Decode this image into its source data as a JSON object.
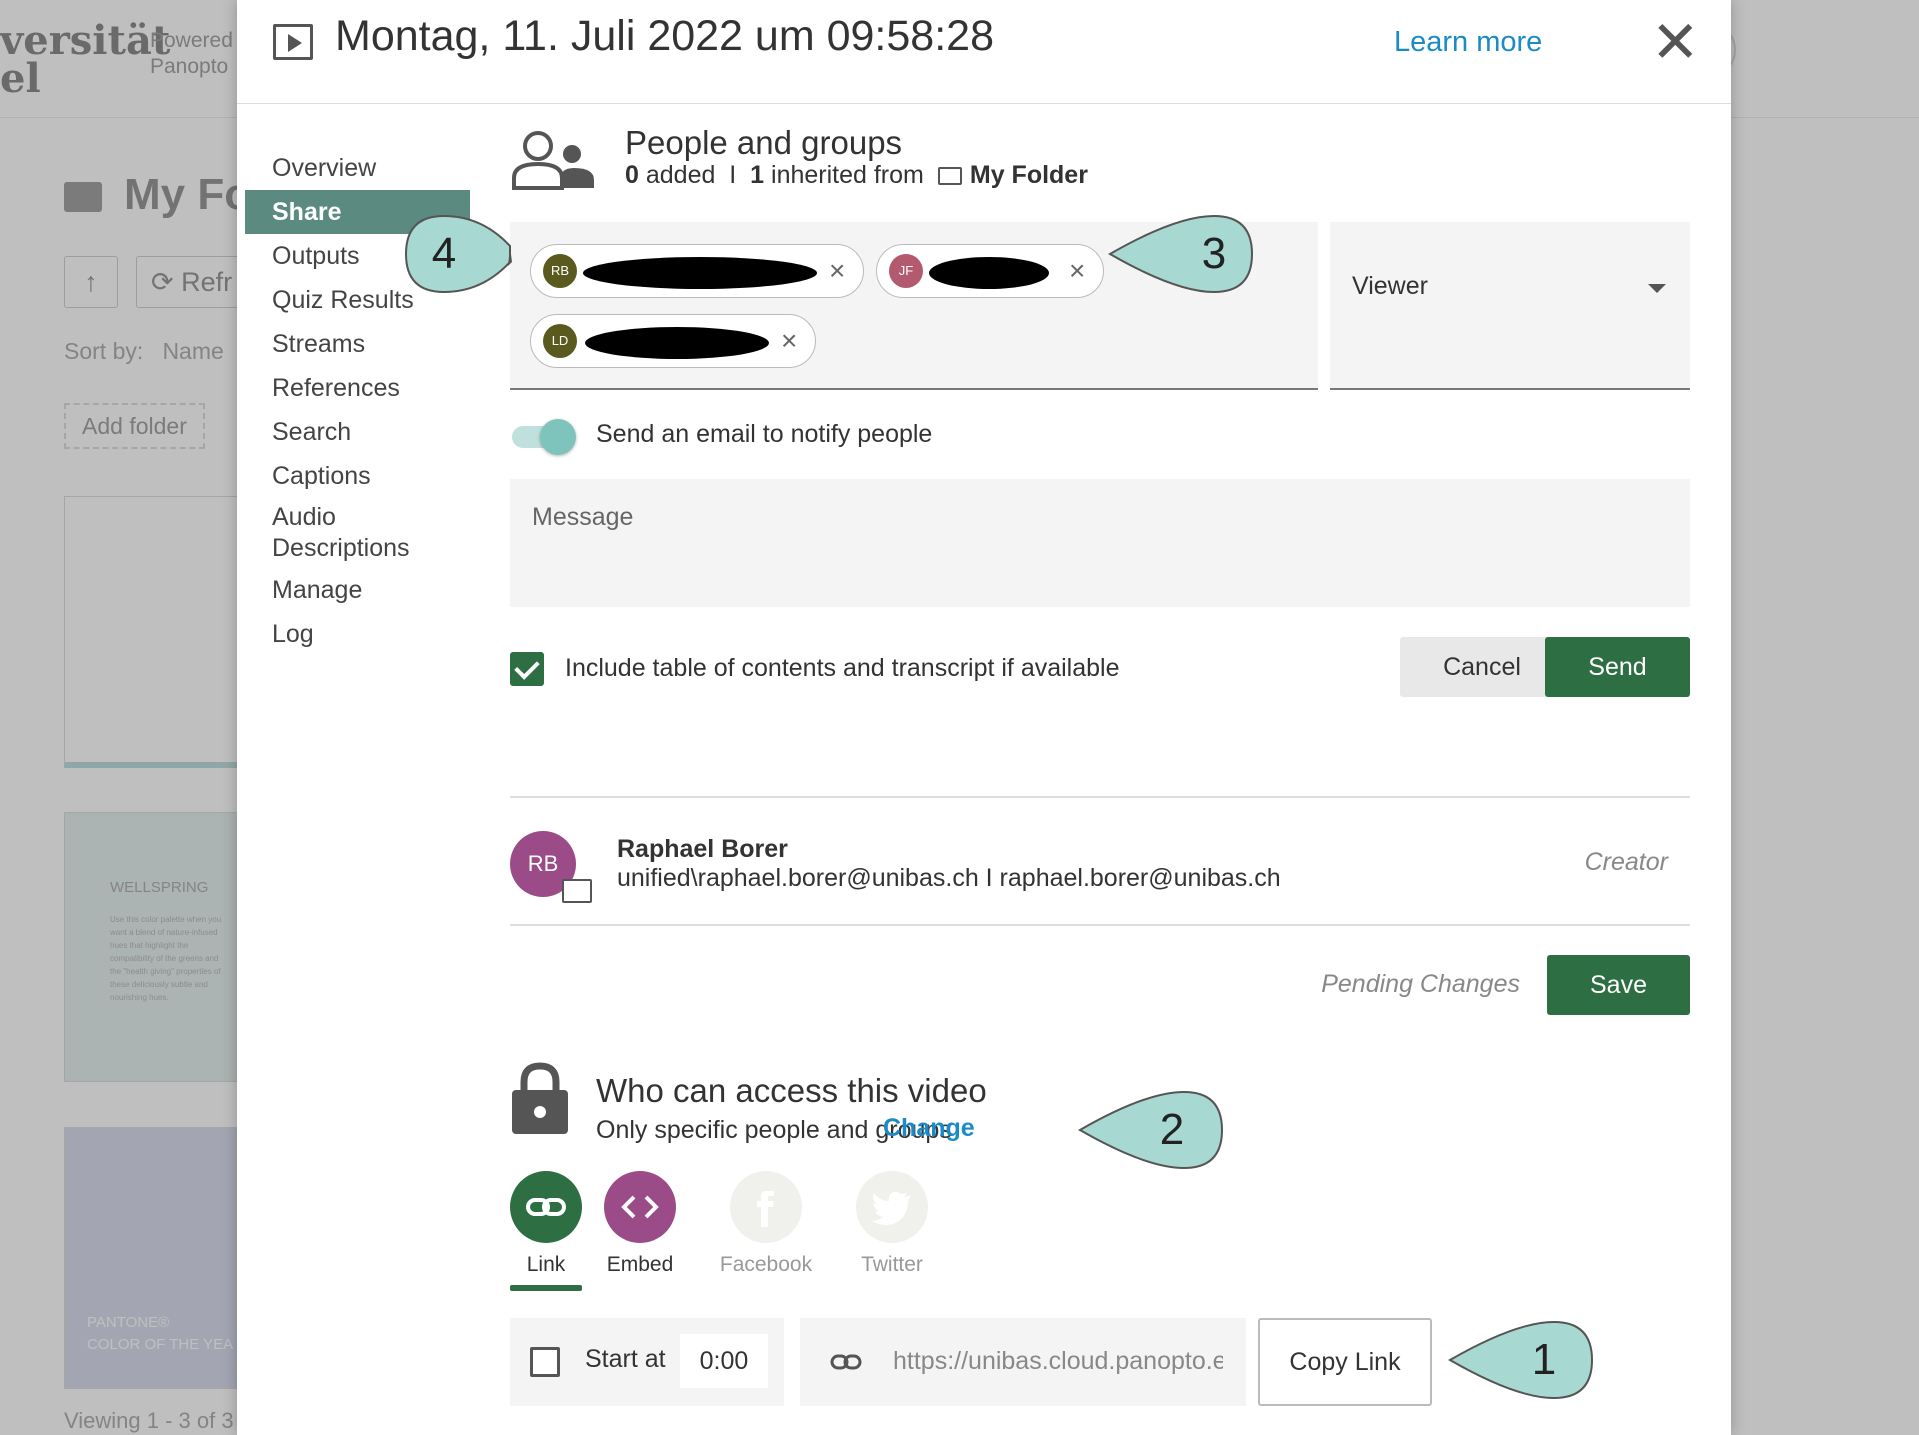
{
  "background": {
    "logo_text": "versität\nel",
    "powered_by": "Powered\nPanopto",
    "folder_title": "My Fo",
    "up_label": "↑",
    "refresh_label": "⟳ Refr",
    "sort_label": "Sort by:",
    "sort_value": "Name",
    "add_folder": "Add folder",
    "card_title": "WELLSPRING",
    "card_body": "Use this color palette when you want a blend of nature-infused hues that highlight the compatibility of the greens and the \"health giving\" properties of these deliciously subtle and nourishing hues.",
    "card3_title": "PANTONE®\nCOLOR OF THE YEA",
    "viewing": "Viewing 1 - 3 of 3"
  },
  "modal": {
    "title": "Montag, 11. Juli 2022 um 09:58:28",
    "learn_more": "Learn more",
    "close_icon": "close-icon"
  },
  "nav": {
    "items": [
      {
        "label": "Overview",
        "active": false
      },
      {
        "label": "Share",
        "active": true
      },
      {
        "label": "Outputs",
        "active": false
      },
      {
        "label": "Quiz Results",
        "active": false
      },
      {
        "label": "Streams",
        "active": false
      },
      {
        "label": "References",
        "active": false
      },
      {
        "label": "Search",
        "active": false
      },
      {
        "label": "Captions",
        "active": false
      },
      {
        "label": "Audio\nDescriptions",
        "active": false
      },
      {
        "label": "Manage",
        "active": false
      },
      {
        "label": "Log",
        "active": false
      }
    ]
  },
  "people": {
    "title": "People and groups",
    "added_count": "0",
    "added_label": "added",
    "separator": "I",
    "inherited_count": "1",
    "inherited_label": "inherited from",
    "folder_name": "My Folder",
    "chips": [
      {
        "initials": "RB",
        "color": "#5a5a1e"
      },
      {
        "initials": "JF",
        "color": "#b35a6e"
      },
      {
        "initials": "LD",
        "color": "#5a5a1e"
      }
    ],
    "role": "Viewer",
    "notify_label": "Send an email to notify people",
    "message_placeholder": "Message",
    "include_label": "Include table of contents and transcript if available",
    "cancel": "Cancel",
    "send": "Send"
  },
  "user": {
    "initials": "RB",
    "name": "Raphael Borer",
    "email": "unified\\raphael.borer@unibas.ch I raphael.borer@unibas.ch",
    "role": "Creator"
  },
  "pending": "Pending Changes",
  "save": "Save",
  "access": {
    "title": "Who can access this video",
    "subtitle": "Only specific people and groups",
    "change": "Change"
  },
  "share_options": [
    {
      "label": "Link",
      "icon": "link-icon",
      "color": "#2e6e43"
    },
    {
      "label": "Embed",
      "icon": "embed-icon",
      "color": "#9a4b88"
    },
    {
      "label": "Facebook",
      "icon": "facebook-icon",
      "color": "#f0f0ec"
    },
    {
      "label": "Twitter",
      "icon": "twitter-icon",
      "color": "#f0f0ec"
    }
  ],
  "link": {
    "start_label": "Start at",
    "start_time": "0:00",
    "url": "https://unibas.cloud.panopto.eu",
    "copy": "Copy Link"
  },
  "callouts": [
    "1",
    "2",
    "3",
    "4"
  ],
  "colors": {
    "accent_green": "#2e6e43",
    "nav_active": "#5b8a80",
    "link_blue": "#1b8ac7",
    "callout_fill": "#a8d8d2"
  }
}
